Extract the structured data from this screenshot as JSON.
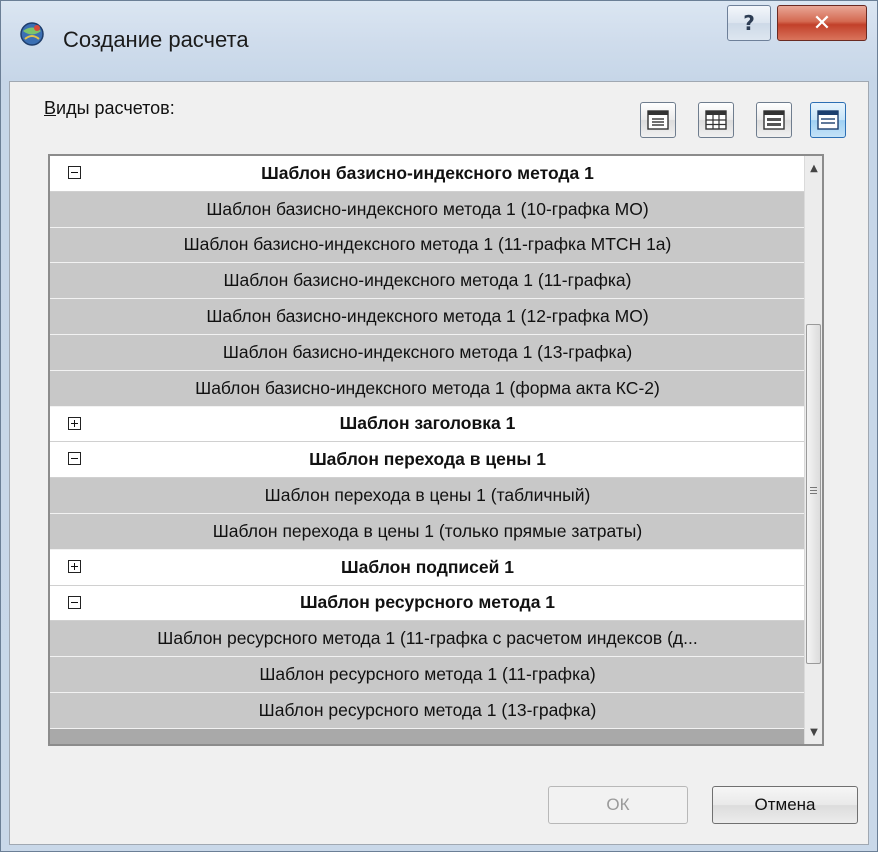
{
  "window": {
    "title": "Создание расчета",
    "help_label": "?",
    "close_label": "✕"
  },
  "section": {
    "label_accel": "В",
    "label_rest": "иды расчетов:"
  },
  "rows": [
    {
      "kind": "group",
      "expanded": true,
      "text": "Шаблон базисно-индексного метода 1"
    },
    {
      "kind": "child",
      "text": "Шаблон базисно-индексного метода 1 (10-графка МО)"
    },
    {
      "kind": "child",
      "text": "Шаблон базисно-индексного метода 1 (11-графка МТСН 1а)"
    },
    {
      "kind": "child",
      "text": "Шаблон базисно-индексного метода 1 (11-графка)"
    },
    {
      "kind": "child",
      "text": "Шаблон базисно-индексного метода 1 (12-графка МО)"
    },
    {
      "kind": "child",
      "text": "Шаблон базисно-индексного метода 1 (13-графка)"
    },
    {
      "kind": "child",
      "text": "Шаблон базисно-индексного метода 1 (форма акта КС-2)"
    },
    {
      "kind": "group",
      "expanded": false,
      "text": "Шаблон заголовка 1"
    },
    {
      "kind": "group",
      "expanded": true,
      "text": "Шаблон перехода в цены 1"
    },
    {
      "kind": "child",
      "text": "Шаблон перехода в цены 1 (табличный)"
    },
    {
      "kind": "child",
      "text": "Шаблон перехода в цены 1 (только прямые затраты)"
    },
    {
      "kind": "group",
      "expanded": false,
      "text": "Шаблон подписей 1"
    },
    {
      "kind": "group",
      "expanded": true,
      "text": "Шаблон ресурсного метода 1"
    },
    {
      "kind": "child",
      "text": "Шаблон ресурсного метода 1 (11-графка с расчетом индексов (д..."
    },
    {
      "kind": "child",
      "text": "Шаблон ресурсного метода 1 (11-графка)"
    },
    {
      "kind": "child",
      "text": "Шаблон ресурсного метода 1 (13-графка)"
    }
  ],
  "buttons": {
    "ok": "ОК",
    "cancel": "Отмена"
  },
  "colors": {
    "group_row": "#ffffff",
    "child_row": "#c8c8c8",
    "close_button": "#c2402a",
    "active_view": "#9fd0f3"
  }
}
